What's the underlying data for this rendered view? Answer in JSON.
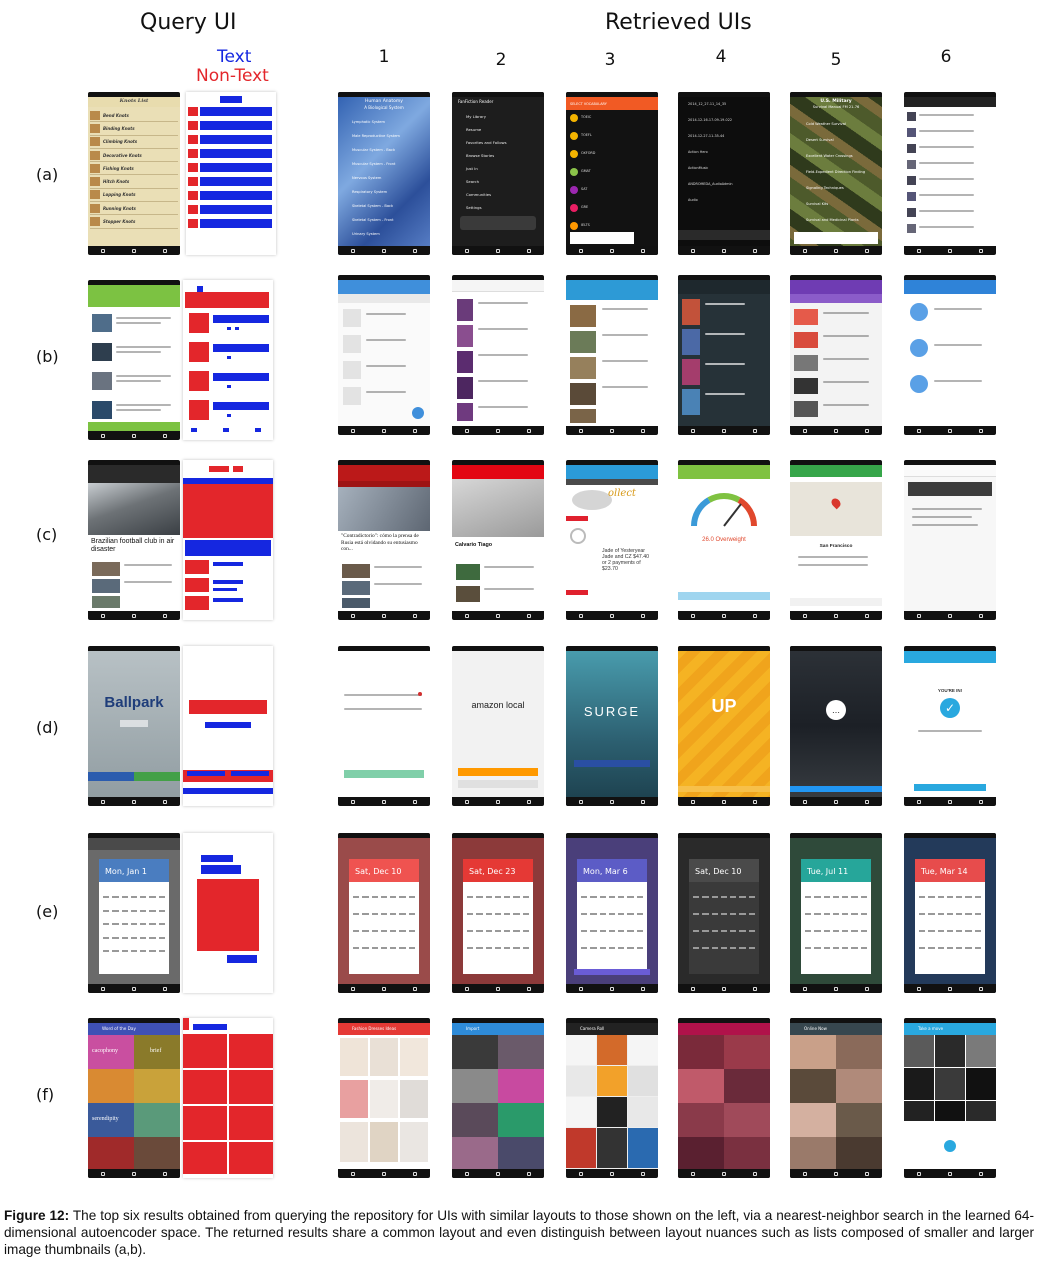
{
  "headers": {
    "query": "Query UI",
    "retrieved": "Retrieved UIs"
  },
  "legend": {
    "text": "Text",
    "non_text": "Non-Text",
    "text_color": "#1527e0",
    "non_text_color": "#e3262b"
  },
  "columns": [
    "1",
    "2",
    "3",
    "4",
    "5",
    "6"
  ],
  "rows": [
    {
      "label": "(a)",
      "query_list": {
        "title": "Knots List",
        "items": [
          "Bend Knots",
          "Binding Knots",
          "Climbing Knots",
          "Decorative Knots",
          "Fishing Knots",
          "Hitch Knots",
          "Lopping Knots",
          "Running Knots",
          "Stopper Knots"
        ]
      },
      "retrieved": [
        {
          "title": "Human Anatomy",
          "subtitle": "A Biological System",
          "items": [
            "Lymphatic System",
            "Male Reproductive System",
            "Muscular System - Back",
            "Muscular System - Front",
            "Nervous System",
            "Respiratory System",
            "Skeletal System - Back",
            "Skeletal System - Front",
            "Urinary System"
          ]
        },
        {
          "title": "FanFiction Reader",
          "items": [
            "My Library",
            "Resume",
            "Favorites and Follows",
            "Browse Stories",
            "Just In",
            "Search",
            "Communities",
            "Settings"
          ]
        },
        {
          "title": "SELECT VOCABULARY",
          "items": [
            "TOEIC",
            "TOEFL",
            "OXFORD",
            "GMAT",
            "SAT",
            "GRE",
            "IELTS"
          ]
        },
        {
          "items": [
            "2014_12_27-11_14_35",
            "2014-12-16-17-09-19-022",
            "2014-12-27-11-35-44",
            "Action Hero",
            "ActionMusic",
            "ANDROMEDA_AudioAdmin",
            "Audio"
          ]
        },
        {
          "title": "U.S. Military",
          "subtitle": "Survival Manual FM 21-76",
          "items": [
            "Cold Weather Survival",
            "Desert Survival",
            "Excellent Water Crossings",
            "Field-Expedient Direction Finding",
            "Signaling Techniques",
            "Survival Kits",
            "Survival and Medicinal Plants"
          ]
        },
        {
          "items": []
        }
      ]
    },
    {
      "label": "(b)"
    },
    {
      "label": "(c)",
      "query_headline": "Brazilian football club in air disaster",
      "retrieved_text": [
        "\"Contradictorio\": cómo la prensa de Rusia está olvidando su entusiasmo con...",
        "Calvario Tiago",
        "Jade of Yesteryear Jade and CZ $47.40 or 2 payments of $23.70",
        "26.0 Overweight",
        "San Francisco",
        ""
      ]
    },
    {
      "label": "(d)",
      "query_brand": "Ballpark",
      "retrieved_text": [
        "",
        "amazon local",
        "SURGE",
        "UP",
        "",
        "YOU'RE IN!"
      ]
    },
    {
      "label": "(e)",
      "query_date": "Mon, Jan 1",
      "retrieved_dates": [
        "Sat, Dec 10",
        "Sat, Dec 23",
        "Mon, Mar 6",
        "Sat, Dec 10",
        "Tue, Jul 11",
        "Tue, Mar 14"
      ]
    },
    {
      "label": "(f)",
      "query_title": "Word of the Day",
      "query_words": [
        "cacophony",
        "brief",
        "",
        "",
        "serendipity",
        "",
        "",
        ""
      ],
      "retrieved_titles": [
        "Fashion Dresses Ideas",
        "Import",
        "Camera Roll",
        "",
        "Online Now",
        "Take a move"
      ]
    }
  ],
  "caption": {
    "label": "Figure 12:",
    "text": "The top six results obtained from querying the repository for UIs with similar layouts to those shown on the left, via a nearest-neighbor search in the learned 64-dimensional autoencoder space.  The returned results share a common layout and even distinguish between layout nuances such as lists composed of smaller and larger image thumbnails (a,b)."
  }
}
